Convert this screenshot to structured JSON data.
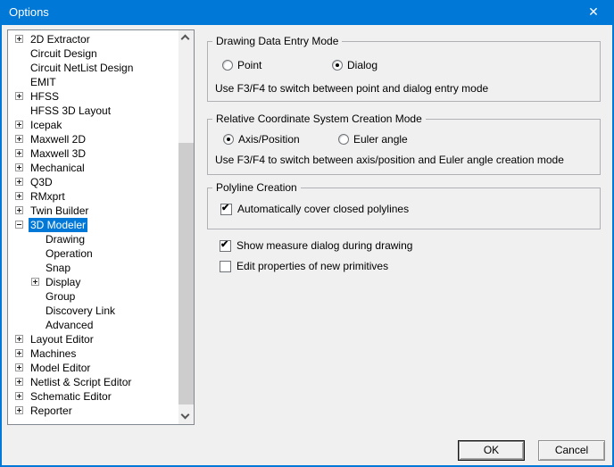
{
  "window": {
    "title": "Options",
    "close_icon": "✕"
  },
  "colors": {
    "titlebar": "#0078d7",
    "selection": "#0078d7",
    "dialog_bg": "#f0f0f0"
  },
  "tree": {
    "items": [
      {
        "label": "2D Extractor",
        "glyph": "plus",
        "level": 0,
        "selected": false
      },
      {
        "label": "Circuit Design",
        "glyph": "none",
        "level": 0,
        "selected": false
      },
      {
        "label": "Circuit NetList Design",
        "glyph": "none",
        "level": 0,
        "selected": false
      },
      {
        "label": "EMIT",
        "glyph": "none",
        "level": 0,
        "selected": false
      },
      {
        "label": "HFSS",
        "glyph": "plus",
        "level": 0,
        "selected": false
      },
      {
        "label": "HFSS 3D Layout",
        "glyph": "none",
        "level": 0,
        "selected": false
      },
      {
        "label": "Icepak",
        "glyph": "plus",
        "level": 0,
        "selected": false
      },
      {
        "label": "Maxwell 2D",
        "glyph": "plus",
        "level": 0,
        "selected": false
      },
      {
        "label": "Maxwell 3D",
        "glyph": "plus",
        "level": 0,
        "selected": false
      },
      {
        "label": "Mechanical",
        "glyph": "plus",
        "level": 0,
        "selected": false
      },
      {
        "label": "Q3D",
        "glyph": "plus",
        "level": 0,
        "selected": false
      },
      {
        "label": "RMxprt",
        "glyph": "plus",
        "level": 0,
        "selected": false
      },
      {
        "label": "Twin Builder",
        "glyph": "plus",
        "level": 0,
        "selected": false
      },
      {
        "label": "3D Modeler",
        "glyph": "minus",
        "level": 0,
        "selected": true
      },
      {
        "label": "Drawing",
        "glyph": "none",
        "level": 1,
        "selected": false
      },
      {
        "label": "Operation",
        "glyph": "none",
        "level": 1,
        "selected": false
      },
      {
        "label": "Snap",
        "glyph": "none",
        "level": 1,
        "selected": false
      },
      {
        "label": "Display",
        "glyph": "plus",
        "level": 1,
        "selected": false
      },
      {
        "label": "Group",
        "glyph": "none",
        "level": 1,
        "selected": false
      },
      {
        "label": "Discovery Link",
        "glyph": "none",
        "level": 1,
        "selected": false
      },
      {
        "label": "Advanced",
        "glyph": "none",
        "level": 1,
        "selected": false
      },
      {
        "label": "Layout Editor",
        "glyph": "plus",
        "level": 0,
        "selected": false
      },
      {
        "label": "Machines",
        "glyph": "plus",
        "level": 0,
        "selected": false
      },
      {
        "label": "Model Editor",
        "glyph": "plus",
        "level": 0,
        "selected": false
      },
      {
        "label": "Netlist & Script Editor",
        "glyph": "plus",
        "level": 0,
        "selected": false
      },
      {
        "label": "Schematic Editor",
        "glyph": "plus",
        "level": 0,
        "selected": false
      },
      {
        "label": "Reporter",
        "glyph": "plus",
        "level": 0,
        "selected": false
      }
    ]
  },
  "panel": {
    "groups": [
      {
        "title": "Drawing Data Entry Mode",
        "radios": [
          {
            "label": "Point",
            "selected": false
          },
          {
            "label": "Dialog",
            "selected": true
          }
        ],
        "hint": "Use F3/F4 to switch between point and dialog entry mode"
      },
      {
        "title": "Relative Coordinate System Creation Mode",
        "radios": [
          {
            "label": "Axis/Position",
            "selected": true
          },
          {
            "label": "Euler angle",
            "selected": false
          }
        ],
        "hint": "Use F3/F4 to switch between axis/position and Euler angle creation mode"
      },
      {
        "title": "Polyline Creation",
        "checkboxes": [
          {
            "label": "Automatically cover closed polylines",
            "checked": true
          }
        ]
      }
    ],
    "checkboxes": [
      {
        "label": "Show measure dialog during drawing",
        "checked": true
      },
      {
        "label": "Edit properties of new primitives",
        "checked": false
      }
    ]
  },
  "buttons": {
    "ok": "OK",
    "cancel": "Cancel"
  }
}
